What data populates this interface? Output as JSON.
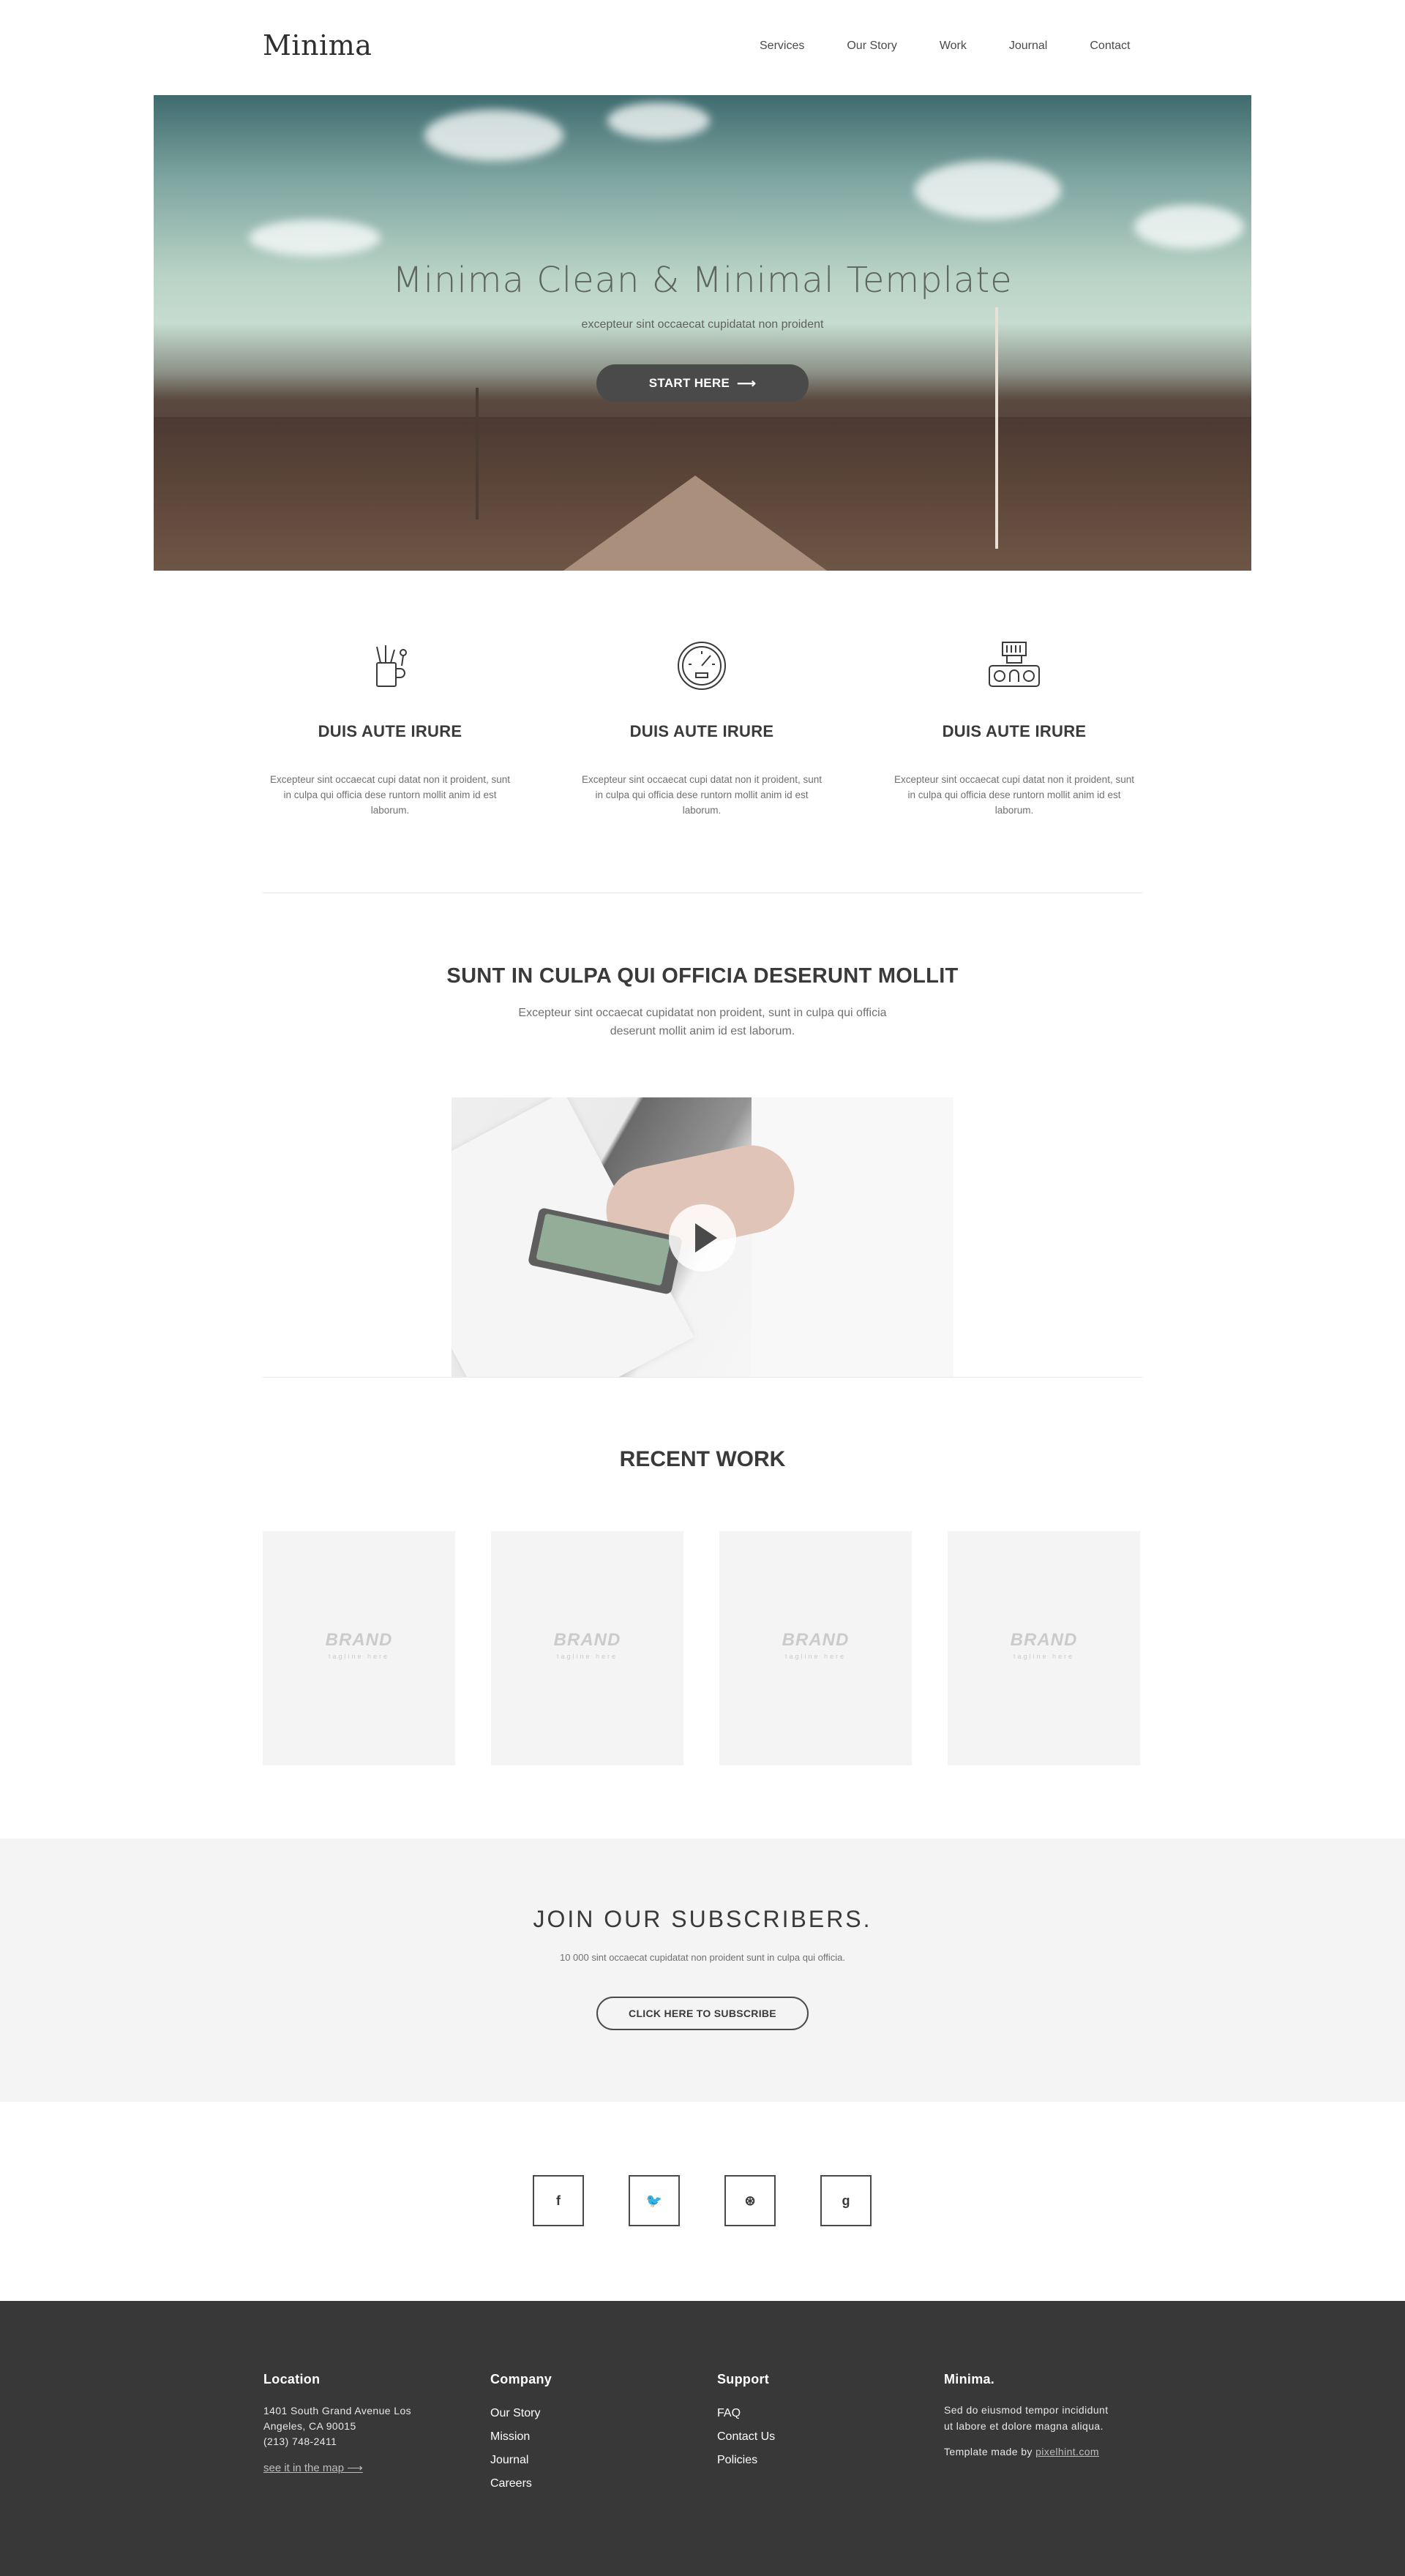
{
  "header": {
    "logo": "Minima",
    "nav": [
      "Services",
      "Our Story",
      "Work",
      "Journal",
      "Contact"
    ]
  },
  "hero": {
    "title": "Minima Clean & Minimal Template",
    "subtitle": "excepteur sint occaecat cupidatat non proident",
    "button_label": "START HERE",
    "button_arrow": "⟶"
  },
  "features": [
    {
      "icon": "pencil-cup-icon",
      "title": "DUIS AUTE IRURE",
      "text": "Excepteur sint occaecat cupi datat non it proident, sunt in culpa qui officia dese runtorn mollit anim id est laborum."
    },
    {
      "icon": "speedometer-icon",
      "title": "DUIS AUTE IRURE",
      "text": "Excepteur sint occaecat cupi datat non it proident, sunt in culpa qui officia dese runtorn mollit anim id est laborum."
    },
    {
      "icon": "camera-gear-icon",
      "title": "DUIS AUTE IRURE",
      "text": "Excepteur sint occaecat cupi datat non it proident, sunt in culpa qui officia dese runtorn mollit anim id est laborum."
    }
  ],
  "intro": {
    "title": "SUNT IN CULPA QUI OFFICIA DESERUNT MOLLIT",
    "text": "Excepteur sint occaecat cupidatat non proident, sunt in culpa qui officia deserunt mollit anim id est laborum."
  },
  "video": {
    "play_icon": "play-icon"
  },
  "recent_work": {
    "title": "RECENT WORK",
    "tiles": [
      {
        "brand": "BRAND",
        "tagline": "tagline here"
      },
      {
        "brand": "BRAND",
        "tagline": "tagline here"
      },
      {
        "brand": "BRAND",
        "tagline": "tagline here"
      },
      {
        "brand": "BRAND",
        "tagline": "tagline here"
      }
    ]
  },
  "subscribe": {
    "title": "JOIN OUR SUBSCRIBERS.",
    "text": "10 000 sint occaecat cupidatat non proident sunt in culpa qui officia.",
    "button_label": "CLICK HERE TO SUBSCRIBE"
  },
  "social": [
    {
      "icon": "facebook-icon",
      "glyph": "f"
    },
    {
      "icon": "twitter-icon",
      "glyph": "🐦"
    },
    {
      "icon": "dribbble-icon",
      "glyph": "⊛"
    },
    {
      "icon": "google-plus-icon",
      "glyph": "g"
    }
  ],
  "footer": {
    "location": {
      "title": "Location",
      "address_line1": "1401 South Grand Avenue Los",
      "address_line2": "Angeles, CA 90015",
      "phone": "(213) 748-2411",
      "map_link": "see it in the map ⟶"
    },
    "company": {
      "title": "Company",
      "links": [
        "Our Story",
        "Mission",
        "Journal",
        "Careers"
      ]
    },
    "support": {
      "title": "Support",
      "links": [
        "FAQ",
        "Contact Us",
        "Policies"
      ]
    },
    "about": {
      "title": "Minima.",
      "text_line1": "Sed do eiusmod tempor incididunt",
      "text_line2": "ut labore et dolore magna aliqua.",
      "credit_prefix": "Template made by",
      "credit_link": "pixelhint.com"
    }
  },
  "colors": {
    "text_dark": "#3a3a3a",
    "text_muted": "#707070",
    "button_dark": "#4a4a4a",
    "tile_bg": "#f4f4f4",
    "footer_bg": "#383838"
  }
}
